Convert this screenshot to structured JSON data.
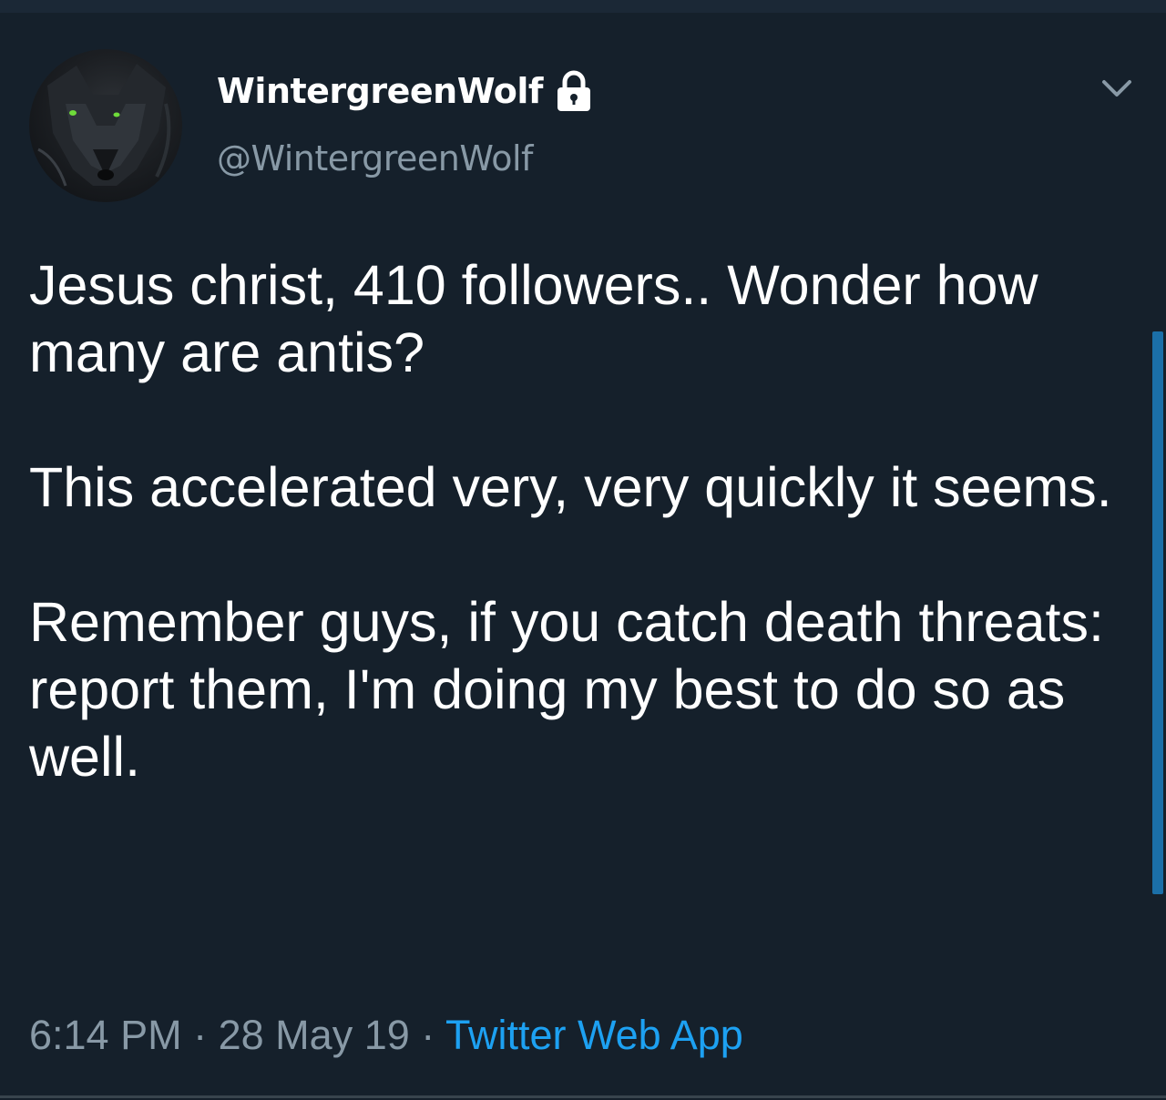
{
  "user": {
    "display_name": "WintergreenWolf",
    "handle": "@WintergreenWolf",
    "avatar_icon": "wolf-avatar",
    "protected_icon": "lock-icon"
  },
  "tweet": {
    "paragraphs": [
      "Jesus christ, 410 followers.. Wonder how many are antis?",
      "This accelerated very, very quickly it seems.",
      "Remember guys, if you catch death threats: report them, I'm doing my best to do so as well."
    ],
    "time": "6:14 PM",
    "date": "28 May 19",
    "separator": "·",
    "source": "Twitter Web App"
  },
  "menu": {
    "icon": "chevron-down-icon"
  },
  "colors": {
    "background": "#15202b",
    "text": "#ffffff",
    "secondary_text": "#8899a6",
    "accent": "#1da1f2"
  }
}
